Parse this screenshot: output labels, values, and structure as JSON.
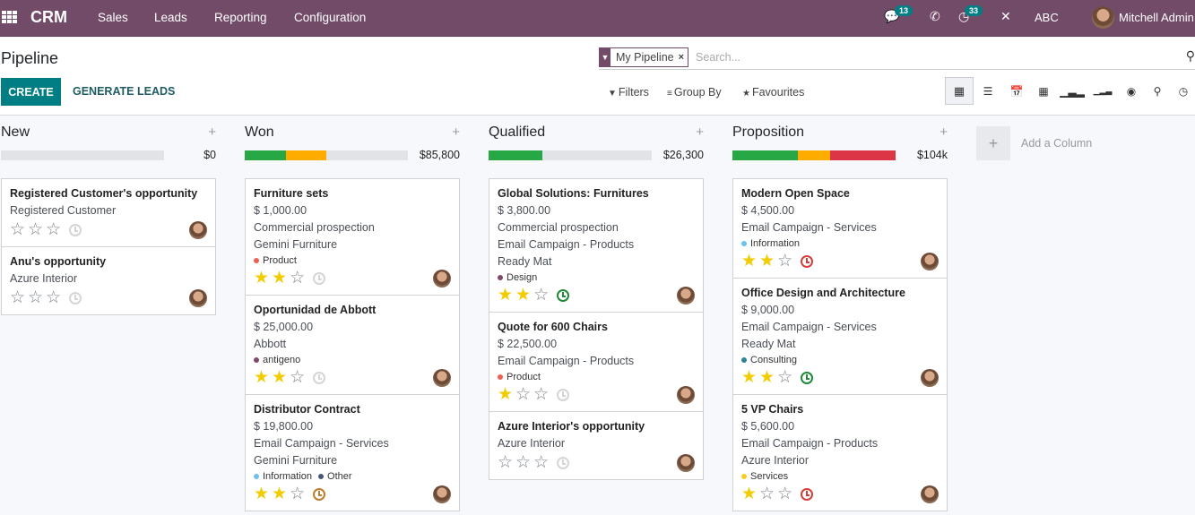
{
  "navbar": {
    "app_name": "CRM",
    "menu": [
      "Sales",
      "Leads",
      "Reporting",
      "Configuration"
    ],
    "messages_badge": "13",
    "activities_badge": "33",
    "company": "ABC",
    "user": "Mitchell Admin",
    "brand_color": "#714b67"
  },
  "control_panel": {
    "title": "Pipeline",
    "create_label": "CREATE",
    "generate_label": "GENERATE LEADS",
    "facet_label": "My Pipeline",
    "search_placeholder": "Search...",
    "filters_label": "Filters",
    "groupby_label": "Group By",
    "favourites_label": "Favourites",
    "views": [
      "kanban",
      "list",
      "calendar",
      "pivot",
      "graph",
      "cohort",
      "dashboard",
      "map",
      "activity"
    ],
    "active_view": "kanban"
  },
  "kanban": {
    "add_column_label": "Add a Column",
    "columns": [
      {
        "title": "New",
        "total": "$0",
        "progress": [],
        "cards": [
          {
            "title": "Registered Customer's opportunity",
            "lines": [
              "Registered Customer"
            ],
            "tags": [],
            "stars": 0,
            "activity": "none"
          },
          {
            "title": "Anu's opportunity",
            "lines": [
              "Azure Interior"
            ],
            "tags": [],
            "stars": 0,
            "activity": "none"
          }
        ]
      },
      {
        "title": "Won",
        "total": "$85,800",
        "progress": [
          {
            "status": "planned",
            "fraction": 0.25,
            "color": "#28a745"
          },
          {
            "status": "today",
            "fraction": 0.25,
            "color": "#ffac00"
          }
        ],
        "cards": [
          {
            "title": "Furniture sets",
            "lines": [
              "$ 1,000.00",
              "Commercial prospection",
              "Gemini Furniture"
            ],
            "tags": [
              {
                "label": "Product",
                "color": "#f06050"
              }
            ],
            "stars": 2,
            "activity": "none"
          },
          {
            "title": "Oportunidad de Abbott",
            "lines": [
              "$ 25,000.00",
              "Abbott"
            ],
            "tags": [
              {
                "label": "antigeno",
                "color": "#814968"
              }
            ],
            "stars": 2,
            "activity": "none"
          },
          {
            "title": "Distributor Contract",
            "lines": [
              "$ 19,800.00",
              "Email Campaign - Services",
              "Gemini Furniture"
            ],
            "tags": [
              {
                "label": "Information",
                "color": "#6cc1ed"
              },
              {
                "label": "Other",
                "color": "#475577"
              }
            ],
            "stars": 2,
            "activity": "today"
          }
        ]
      },
      {
        "title": "Qualified",
        "total": "$26,300",
        "progress": [
          {
            "status": "planned",
            "fraction": 0.33,
            "color": "#28a745"
          }
        ],
        "cards": [
          {
            "title": "Global Solutions: Furnitures",
            "lines": [
              "$ 3,800.00",
              "Commercial prospection",
              "Email Campaign - Products",
              "Ready Mat"
            ],
            "tags": [
              {
                "label": "Design",
                "color": "#814968"
              }
            ],
            "stars": 2,
            "activity": "planned"
          },
          {
            "title": "Quote for 600 Chairs",
            "lines": [
              "$ 22,500.00",
              "Email Campaign - Products"
            ],
            "tags": [
              {
                "label": "Product",
                "color": "#f06050"
              }
            ],
            "stars": 1,
            "activity": "none"
          },
          {
            "title": "Azure Interior's opportunity",
            "lines": [
              "Azure Interior"
            ],
            "tags": [],
            "stars": 0,
            "activity": "none"
          }
        ]
      },
      {
        "title": "Proposition",
        "total": "$104k",
        "progress": [
          {
            "status": "planned",
            "fraction": 0.4,
            "color": "#28a745"
          },
          {
            "status": "today",
            "fraction": 0.2,
            "color": "#ffac00"
          },
          {
            "status": "overdue",
            "fraction": 0.4,
            "color": "#dc3545"
          }
        ],
        "cards": [
          {
            "title": "Modern Open Space",
            "lines": [
              "$ 4,500.00",
              "Email Campaign - Services"
            ],
            "tags": [
              {
                "label": "Information",
                "color": "#6cc1ed"
              }
            ],
            "stars": 2,
            "activity": "overdue"
          },
          {
            "title": "Office Design and Architecture",
            "lines": [
              "$ 9,000.00",
              "Email Campaign - Services",
              "Ready Mat"
            ],
            "tags": [
              {
                "label": "Consulting",
                "color": "#2c8397"
              }
            ],
            "stars": 2,
            "activity": "planned"
          },
          {
            "title": "5 VP Chairs",
            "lines": [
              "$ 5,600.00",
              "Email Campaign - Products",
              "Azure Interior"
            ],
            "tags": [
              {
                "label": "Services",
                "color": "#f7cd1f"
              }
            ],
            "stars": 1,
            "activity": "overdue"
          }
        ]
      }
    ]
  }
}
